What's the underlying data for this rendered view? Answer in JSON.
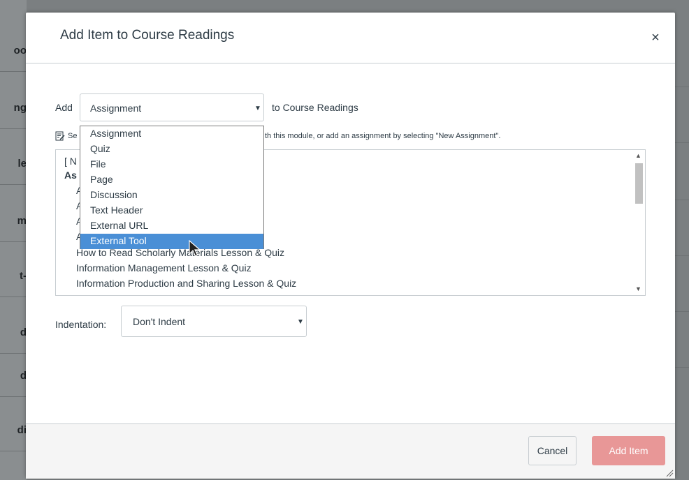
{
  "background_page": {
    "row_fragments": [
      "oo",
      "ng",
      "le",
      "m",
      "t-",
      "d",
      "d",
      "di"
    ]
  },
  "dialog": {
    "title": "Add Item to Course Readings",
    "close_label": "×"
  },
  "add_row": {
    "add_label": "Add",
    "selected_type": "Assignment",
    "to_label": "to Course Readings"
  },
  "hint": {
    "icon": "edit-note-icon",
    "visible_start": "Se",
    "visible_end": "th this module, or add an assignment by selecting \"New Assignment\"."
  },
  "type_options": [
    {
      "label": "Assignment",
      "selected": false
    },
    {
      "label": "Quiz",
      "selected": false
    },
    {
      "label": "File",
      "selected": false
    },
    {
      "label": "Page",
      "selected": false
    },
    {
      "label": "Discussion",
      "selected": false
    },
    {
      "label": "Text Header",
      "selected": false
    },
    {
      "label": "External URL",
      "selected": false
    },
    {
      "label": "External Tool",
      "selected": true
    }
  ],
  "assignment_list": {
    "partial_lines": [
      "[ N",
      "As",
      "A",
      "A",
      "A",
      "A"
    ],
    "items": [
      "How to Read Scholarly Materials Lesson & Quiz",
      "Information Management Lesson & Quiz",
      "Information Production and Sharing Lesson & Quiz"
    ]
  },
  "indentation": {
    "label": "Indentation:",
    "selected": "Don't Indent"
  },
  "footer": {
    "cancel_label": "Cancel",
    "add_label": "Add Item"
  },
  "colors": {
    "selected_option": "#4a8fd6",
    "add_button": "#e89797",
    "overlay": "#7b7f81"
  }
}
